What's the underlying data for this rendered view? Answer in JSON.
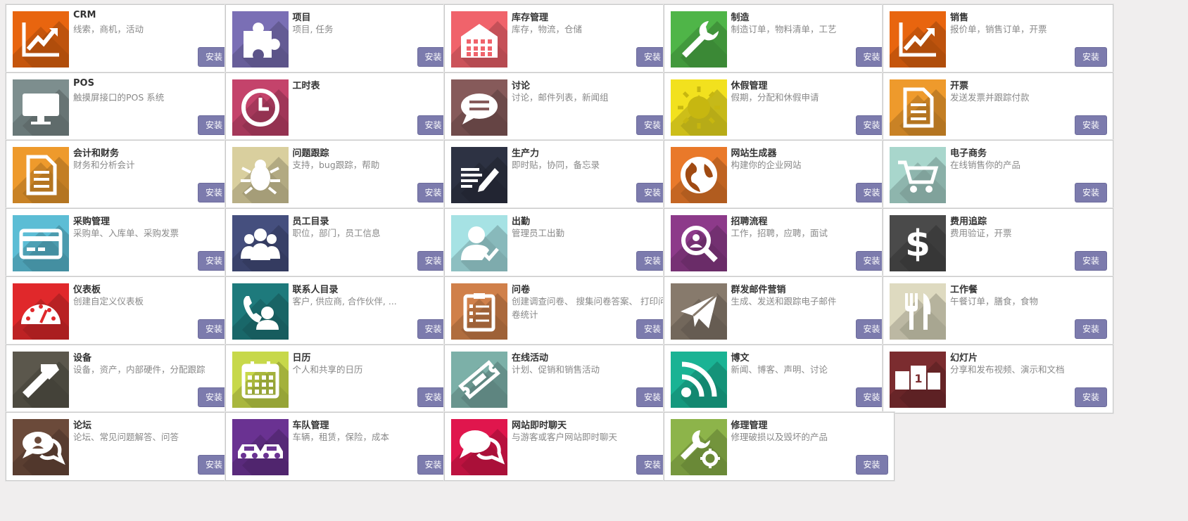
{
  "install_label": "安装",
  "apps": [
    {
      "name": "CRM",
      "desc": "线索，商机，活动",
      "color": "#e8650f",
      "icon": "trend-chart-icon"
    },
    {
      "name": "项目",
      "desc": "项目, 任务",
      "color": "#7a6fb5",
      "icon": "puzzle-icon"
    },
    {
      "name": "库存管理",
      "desc": "库存，物流，仓储",
      "color": "#f0636b",
      "icon": "warehouse-icon"
    },
    {
      "name": "制造",
      "desc": "制造订单，物料清单，工艺",
      "color": "#4fb548",
      "icon": "wrench-icon"
    },
    {
      "name": "销售",
      "desc": "报价单，销售订单，开票",
      "color": "#e8650f",
      "icon": "trend-chart-icon"
    },
    {
      "name": "POS",
      "desc": "触摸屏接口的POS 系统",
      "color": "#7d8e8e",
      "icon": "monitor-icon"
    },
    {
      "name": "工时表",
      "desc": "",
      "color": "#c4436b",
      "icon": "clock-icon"
    },
    {
      "name": "讨论",
      "desc": "讨论，邮件列表，新闻组",
      "color": "#865a5a",
      "icon": "chat-bubble-icon"
    },
    {
      "name": "休假管理",
      "desc": "假期，分配和休假申请",
      "color": "#f2e11e",
      "icon": "sun-icon"
    },
    {
      "name": "开票",
      "desc": "发送发票并跟踪付款",
      "color": "#ee9a2c",
      "icon": "document-icon"
    },
    {
      "name": "会计和财务",
      "desc": "财务和分析会计",
      "color": "#ee9a2c",
      "icon": "document-icon"
    },
    {
      "name": "问题跟踪",
      "desc": "支持，bug跟踪，帮助",
      "color": "#d9cf9e",
      "icon": "bug-icon"
    },
    {
      "name": "生产力",
      "desc": "即时贴，协同，备忘录",
      "color": "#2d3243",
      "icon": "notes-pencil-icon"
    },
    {
      "name": "网站生成器",
      "desc": "构建你的企业网站",
      "color": "#e9792a",
      "icon": "globe-icon"
    },
    {
      "name": "电子商务",
      "desc": "在线销售你的产品",
      "color": "#a8d6cc",
      "icon": "shopping-cart-icon"
    },
    {
      "name": "采购管理",
      "desc": "采购单、入库单、采购发票",
      "color": "#5cbdd5",
      "icon": "credit-card-icon"
    },
    {
      "name": "员工目录",
      "desc": "职位，部门，员工信息",
      "color": "#454f7e",
      "icon": "people-icon"
    },
    {
      "name": "出勤",
      "desc": "管理员工出勤",
      "color": "#a6e2e4",
      "icon": "person-check-icon"
    },
    {
      "name": "招聘流程",
      "desc": "工作，招聘，应聘，面试",
      "color": "#8d3a8a",
      "icon": "magnifier-icon"
    },
    {
      "name": "费用追踪",
      "desc": "费用验证，开票",
      "color": "#4a4a4a",
      "icon": "dollar-icon"
    },
    {
      "name": "仪表板",
      "desc": "创建自定义仪表板",
      "color": "#e0282b",
      "icon": "gauge-icon"
    },
    {
      "name": "联系人目录",
      "desc": "客户, 供应商, 合作伙伴, ...",
      "color": "#1e7a7c",
      "icon": "contact-phone-icon"
    },
    {
      "name": "问卷",
      "desc": "创建调查问卷、 搜集问卷答案、 打印问卷统计",
      "color": "#d0804a",
      "icon": "clipboard-icon"
    },
    {
      "name": "群发邮件营销",
      "desc": "生成、发送和跟踪电子邮件",
      "color": "#877a6c",
      "icon": "paper-plane-icon"
    },
    {
      "name": "工作餐",
      "desc": "午餐订单，膳食，食物",
      "color": "#dedac0",
      "icon": "fork-knife-icon"
    },
    {
      "name": "设备",
      "desc": "设备，资产，内部硬件，分配跟踪",
      "color": "#5b574c",
      "icon": "hammer-icon"
    },
    {
      "name": "日历",
      "desc": "个人和共享的日历",
      "color": "#c7d84a",
      "icon": "calendar-icon"
    },
    {
      "name": "在线活动",
      "desc": "计划、促销和销售活动",
      "color": "#7cb0a8",
      "icon": "ticket-icon"
    },
    {
      "name": "博文",
      "desc": "新闻、博客、声明、讨论",
      "color": "#1ab394",
      "icon": "rss-icon"
    },
    {
      "name": "幻灯片",
      "desc": "分享和发布视频、演示和文档",
      "color": "#7b2c2f",
      "icon": "slides-podium-icon"
    },
    {
      "name": "论坛",
      "desc": "论坛、常见问题解答、问答",
      "color": "#6b4a3a",
      "icon": "forum-bubbles-icon"
    },
    {
      "name": "车队管理",
      "desc": "车辆，租赁，保险，成本",
      "color": "#6a3292",
      "icon": "cars-icon"
    },
    {
      "name": "网站即时聊天",
      "desc": "与游客或客户网站即时聊天",
      "color": "#e0164d",
      "icon": "chat-bubbles-icon"
    },
    {
      "name": "修理管理",
      "desc": "修理破损以及毁坏的产品",
      "color": "#8db44a",
      "icon": "wrench-gear-icon"
    }
  ]
}
